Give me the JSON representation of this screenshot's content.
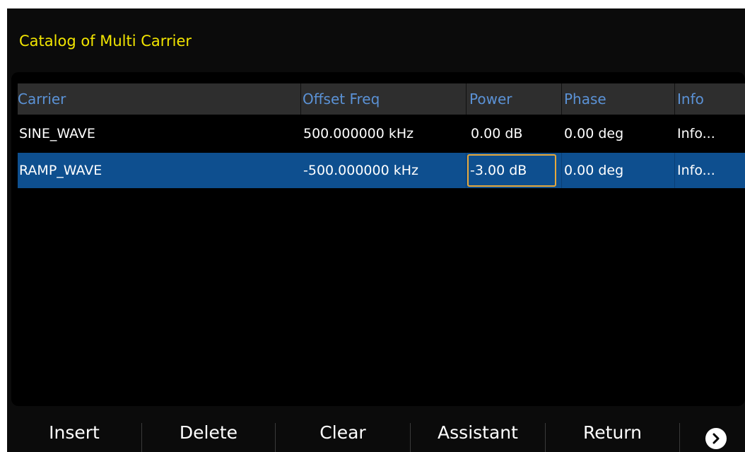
{
  "title": "Catalog of Multi Carrier",
  "table": {
    "columns": [
      "Carrier",
      "Offset Freq",
      "Power",
      "Phase",
      "Info"
    ],
    "rows": [
      {
        "carrier": "SINE_WAVE",
        "offset": "500.000000 kHz",
        "power": "0.00 dB",
        "phase": "0.00 deg",
        "info": "Info..."
      },
      {
        "carrier": "RAMP_WAVE",
        "offset": "-500.000000 kHz",
        "power": "-3.00 dB",
        "phase": "0.00 deg",
        "info": "Info..."
      }
    ]
  },
  "softkeys": {
    "insert": "Insert",
    "delete": "Delete",
    "clear": "Clear",
    "assistant": "Assistant",
    "return": "Return"
  },
  "colors": {
    "title": "#f2e500",
    "header_text": "#5b92d6",
    "selected_row": "#0e4f8f",
    "active_cell_border": "#e7a93c"
  },
  "icons": {
    "next": "chevron-right-circle-icon"
  }
}
